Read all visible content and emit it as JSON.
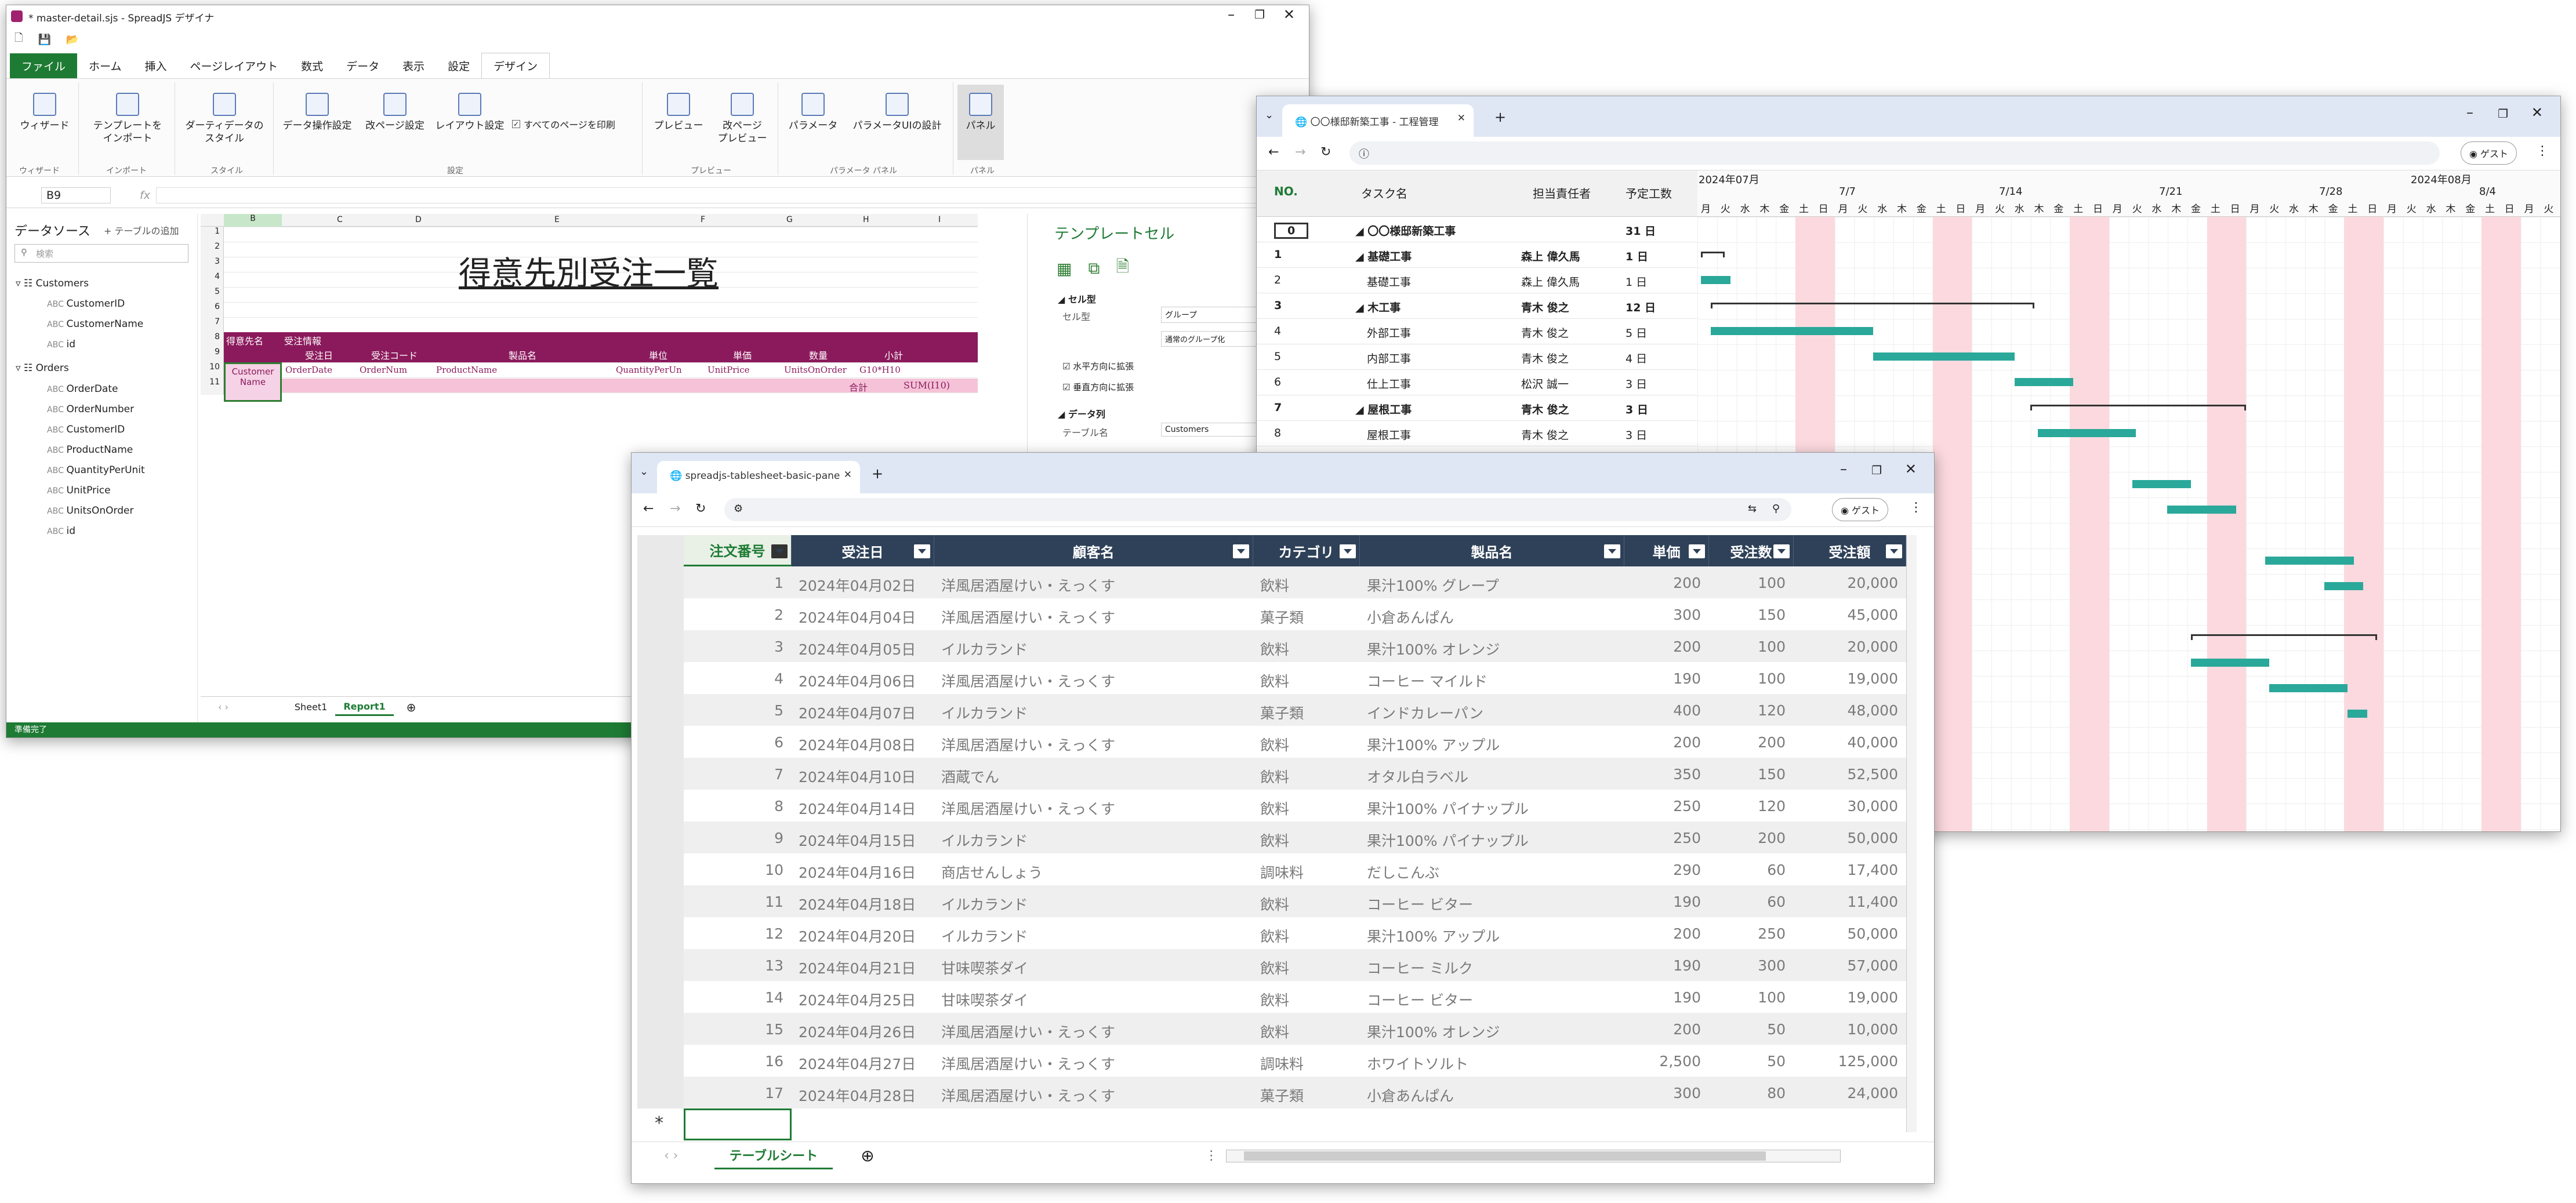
{
  "designer": {
    "title": "* master-detail.sjs - SpreadJS デザイナ",
    "tabs": [
      "ファイル",
      "ホーム",
      "挿入",
      "ページレイアウト",
      "数式",
      "データ",
      "表示",
      "設定",
      "デザイン"
    ],
    "ribbon": {
      "wizard": "ウィザード",
      "import": "テンプレートを\nインポート",
      "dummy": "ダーティデータの\nスタイル",
      "dataop": "データ操作設定",
      "pagebreak": "改ページ設定",
      "layout": "レイアウト設定",
      "printall": "すべてのページを印刷",
      "preview": "プレビュー",
      "pagepreview": "改ページ\nプレビュー",
      "params": "パラメータ",
      "paramui": "パラメータUIの設計",
      "panel": "パネル",
      "groups": [
        "ウィザード",
        "インポート",
        "スタイル",
        "設定",
        "プレビュー",
        "パラメータ パネル",
        "パネル"
      ]
    },
    "cellref": "B9",
    "fx": "fx",
    "datasource": {
      "title": "データソース",
      "add": "+ テーブルの追加",
      "search": "検索",
      "customers": "Customers",
      "customer_fields": [
        "CustomerID",
        "CustomerName",
        "id"
      ],
      "orders": "Orders",
      "order_fields": [
        "OrderDate",
        "OrderNumber",
        "CustomerID",
        "ProductName",
        "QuantityPerUnit",
        "UnitPrice",
        "UnitsOnOrder",
        "id"
      ]
    },
    "cols": [
      "B",
      "C",
      "D",
      "E",
      "F",
      "G",
      "H",
      "I"
    ],
    "rows": [
      "1",
      "2",
      "3",
      "4",
      "5",
      "6",
      "7",
      "8",
      "9",
      "10",
      "11"
    ],
    "report_title": "得意先別受注一覧",
    "hdr_left": "得意先名",
    "hdr_right": "受注情報",
    "sub": [
      "受注日",
      "受注コード",
      "製品名",
      "単位",
      "単価",
      "数量",
      "小計"
    ],
    "cname": "Customer\nName",
    "binds": [
      "OrderDate",
      "OrderNum",
      "ProductName",
      "QuantityPerUn",
      "UnitPrice",
      "UnitsOnOrder",
      "G10*H10"
    ],
    "total_label": "合計",
    "total": "SUM(I10)",
    "sheets": [
      "Sheet1",
      "Report1"
    ],
    "side": {
      "title": "テンプレートセル",
      "celltype_h": "セル型",
      "celltype": "セル型",
      "celltype_val": "グループ",
      "group_val": "通常のグループ化",
      "h": "水平方向に拡張",
      "v": "垂直方向に拡張",
      "datacol": "データ列",
      "tablename": "テーブル名",
      "tablename_val": "Customers"
    },
    "status": "準備完了"
  },
  "gantt": {
    "tab": "〇〇様邸新築工事 - 工程管理",
    "guest": "ゲスト",
    "headers": [
      "NO.",
      "タスク名",
      "担当責任者",
      "予定工数"
    ],
    "months": [
      "2024年07月",
      "2024年08月"
    ],
    "weeks": [
      "7/7",
      "7/14",
      "7/21",
      "7/28",
      "8/4"
    ],
    "days": [
      "月",
      "火",
      "水",
      "木",
      "金",
      "土",
      "日",
      "月",
      "火",
      "水",
      "木",
      "金",
      "土",
      "日",
      "月",
      "火",
      "水",
      "木",
      "金",
      "土",
      "日",
      "月",
      "火",
      "水",
      "木",
      "金",
      "土",
      "日",
      "月",
      "火",
      "水",
      "木",
      "金",
      "土",
      "日",
      "月",
      "火",
      "水",
      "木",
      "金",
      "土",
      "日",
      "月",
      "火"
    ],
    "rows": [
      {
        "no": "0",
        "task": "〇〇様邸新築工事",
        "person": "",
        "days": "31 日"
      },
      {
        "no": "1",
        "task": "基礎工事",
        "person": "森上 偉久馬",
        "days": "1 日"
      },
      {
        "no": "2",
        "task": "基礎工事",
        "person": "森上 偉久馬",
        "days": "1 日"
      },
      {
        "no": "3",
        "task": "木工事",
        "person": "青木 俊之",
        "days": "12 日"
      },
      {
        "no": "4",
        "task": "外部工事",
        "person": "青木 俊之",
        "days": "5 日"
      },
      {
        "no": "5",
        "task": "内部工事",
        "person": "青木 俊之",
        "days": "4 日"
      },
      {
        "no": "6",
        "task": "仕上工事",
        "person": "松沢 誠一",
        "days": "3 日"
      },
      {
        "no": "7",
        "task": "屋根工事",
        "person": "青木 俊之",
        "days": "3 日"
      },
      {
        "no": "8",
        "task": "屋根工事",
        "person": "青木 俊之",
        "days": "3 日"
      }
    ],
    "colors": {
      "bar": "#2aa89a",
      "weekend": "#fbd9de"
    }
  },
  "table": {
    "tab": "spreadjs-tablesheet-basic-pane",
    "guest": "ゲスト",
    "headers": [
      "注文番号",
      "受注日",
      "顧客名",
      "カテゴリ",
      "製品名",
      "単価",
      "受注数",
      "受注額"
    ],
    "rows": [
      [
        "1",
        "2024年04月02日",
        "洋風居酒屋けい・えっくす",
        "飲料",
        "果汁100% グレープ",
        "200",
        "100",
        "20,000"
      ],
      [
        "2",
        "2024年04月04日",
        "洋風居酒屋けい・えっくす",
        "菓子類",
        "小倉あんぱん",
        "300",
        "150",
        "45,000"
      ],
      [
        "3",
        "2024年04月05日",
        "イルカランド",
        "飲料",
        "果汁100% オレンジ",
        "200",
        "100",
        "20,000"
      ],
      [
        "4",
        "2024年04月06日",
        "洋風居酒屋けい・えっくす",
        "飲料",
        "コーヒー マイルド",
        "190",
        "100",
        "19,000"
      ],
      [
        "5",
        "2024年04月07日",
        "イルカランド",
        "菓子類",
        "インドカレーパン",
        "400",
        "120",
        "48,000"
      ],
      [
        "6",
        "2024年04月08日",
        "洋風居酒屋けい・えっくす",
        "飲料",
        "果汁100% アップル",
        "200",
        "200",
        "40,000"
      ],
      [
        "7",
        "2024年04月10日",
        "酒蔵でん",
        "飲料",
        "オタル白ラベル",
        "350",
        "150",
        "52,500"
      ],
      [
        "8",
        "2024年04月14日",
        "洋風居酒屋けい・えっくす",
        "飲料",
        "果汁100% パイナップル",
        "250",
        "120",
        "30,000"
      ],
      [
        "9",
        "2024年04月15日",
        "イルカランド",
        "飲料",
        "果汁100% パイナップル",
        "250",
        "200",
        "50,000"
      ],
      [
        "10",
        "2024年04月16日",
        "商店せんしょう",
        "調味料",
        "だしこんぶ",
        "290",
        "60",
        "17,400"
      ],
      [
        "11",
        "2024年04月18日",
        "イルカランド",
        "飲料",
        "コーヒー ビター",
        "190",
        "60",
        "11,400"
      ],
      [
        "12",
        "2024年04月20日",
        "イルカランド",
        "飲料",
        "果汁100% アップル",
        "200",
        "250",
        "50,000"
      ],
      [
        "13",
        "2024年04月21日",
        "甘味喫茶ダイ",
        "飲料",
        "コーヒー ミルク",
        "190",
        "300",
        "57,000"
      ],
      [
        "14",
        "2024年04月25日",
        "甘味喫茶ダイ",
        "飲料",
        "コーヒー ビター",
        "190",
        "100",
        "19,000"
      ],
      [
        "15",
        "2024年04月26日",
        "洋風居酒屋けい・えっくす",
        "飲料",
        "果汁100% オレンジ",
        "200",
        "50",
        "10,000"
      ],
      [
        "16",
        "2024年04月27日",
        "洋風居酒屋けい・えっくす",
        "調味料",
        "ホワイトソルト",
        "2,500",
        "50",
        "125,000"
      ],
      [
        "17",
        "2024年04月28日",
        "洋風居酒屋けい・えっくす",
        "菓子類",
        "小倉あんぱん",
        "300",
        "80",
        "24,000"
      ]
    ],
    "newrow": "*",
    "sheet": "テーブルシート"
  }
}
